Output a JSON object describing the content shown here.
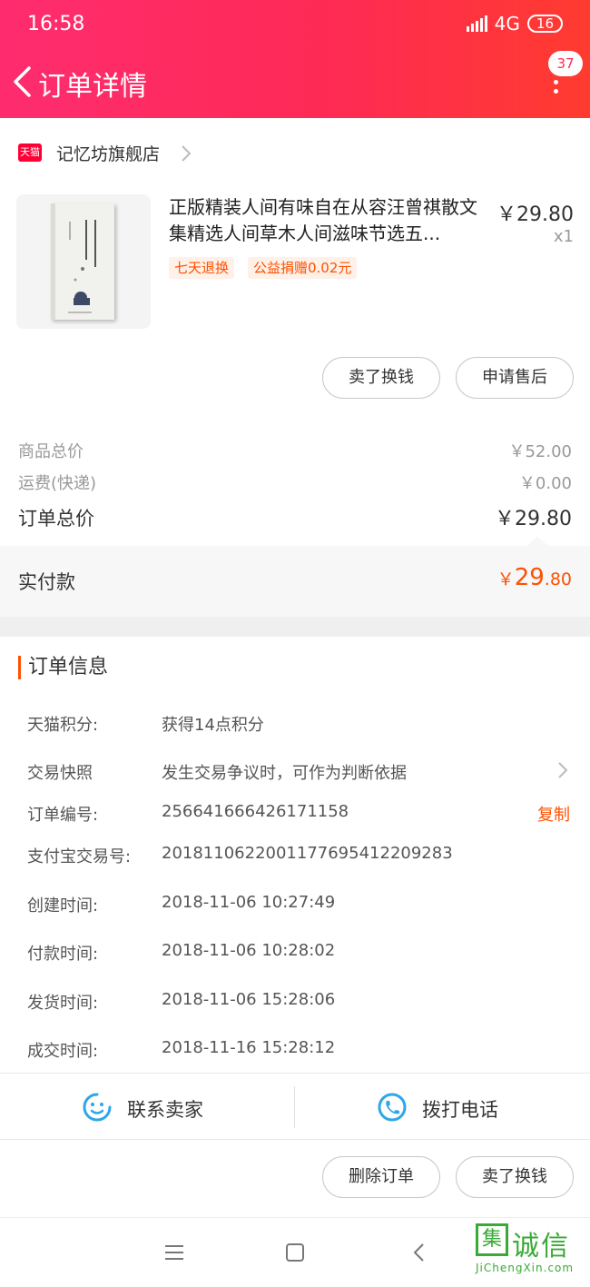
{
  "status_bar": {
    "time": "16:58",
    "network": "4G",
    "battery": "16"
  },
  "header": {
    "title": "订单详情",
    "message_badge": "37"
  },
  "store": {
    "logo_text": "天猫",
    "name": "记忆坊旗舰店"
  },
  "product": {
    "title": "正版精装人间有味自在从容汪曾祺散文集精选人间草木人间滋味节选五...",
    "price": "￥29.80",
    "quantity": "x1",
    "tags": [
      "七天退换",
      "公益捐赠0.02元"
    ]
  },
  "item_actions": {
    "sell_label": "卖了换钱",
    "after_sale_label": "申请售后"
  },
  "summary": {
    "goods_total_label": "商品总价",
    "goods_total_value": "￥52.00",
    "shipping_label": "运费(快递)",
    "shipping_value": "￥0.00",
    "order_total_label": "订单总价",
    "order_total_value": "￥29.80",
    "paid_label": "实付款",
    "paid_currency": "￥",
    "paid_integer": "29",
    "paid_decimal": ".80"
  },
  "order_info": {
    "title": "订单信息",
    "copy_label": "复制",
    "rows": [
      {
        "label": "天猫积分:",
        "value": "获得14点积分"
      },
      {
        "label": "交易快照",
        "value": "发生交易争议时，可作为判断依据"
      },
      {
        "label": "订单编号:",
        "value": "256641666426171158"
      },
      {
        "label": "支付宝交易号:",
        "value": "2018110622001177695412209283"
      },
      {
        "label": "创建时间:",
        "value": "2018-11-06 10:27:49"
      },
      {
        "label": "付款时间:",
        "value": "2018-11-06 10:28:02"
      },
      {
        "label": "发货时间:",
        "value": "2018-11-06 15:28:06"
      },
      {
        "label": "成交时间:",
        "value": "2018-11-16 15:28:12"
      }
    ]
  },
  "contact": {
    "seller_label": "联系卖家",
    "phone_label": "拨打电话"
  },
  "bottom_actions": {
    "delete_label": "删除订单",
    "sell_label": "卖了换钱"
  },
  "watermark": {
    "box_char": "集",
    "big_text": "诚信",
    "url": "JiChengXin.com"
  },
  "colors": {
    "accent": "#ff5000",
    "header_start": "#fe2c6f",
    "header_end": "#ff3b2f",
    "contact_icon": "#2fa6e8"
  }
}
